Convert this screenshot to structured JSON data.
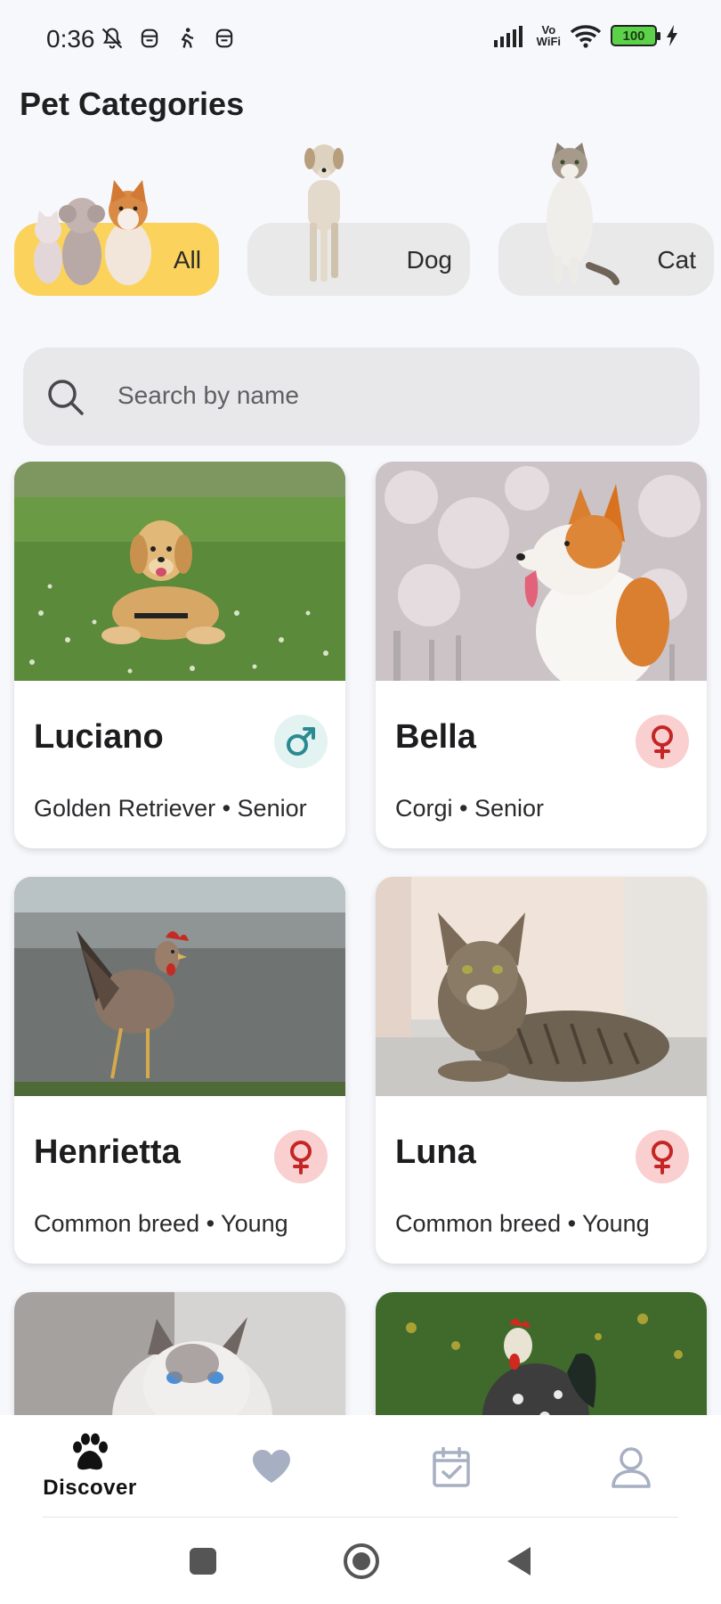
{
  "status_bar": {
    "time": "0:36",
    "left_icons": [
      "bell-off-icon",
      "face-icon",
      "walking-icon",
      "face-icon"
    ],
    "network": "Vo WiFi",
    "battery": "100"
  },
  "categories": {
    "title": "Pet Categories",
    "items": [
      {
        "label": "All",
        "active": true
      },
      {
        "label": "Dog",
        "active": false
      },
      {
        "label": "Cat",
        "active": false
      }
    ]
  },
  "search": {
    "placeholder": "Search by name"
  },
  "pets": [
    {
      "name": "Luciano",
      "breed": "Golden Retriever",
      "age": "Senior",
      "meta": "Golden Retriever • Senior",
      "gender": "male",
      "photo": "golden-retriever-photo"
    },
    {
      "name": "Bella",
      "breed": "Corgi",
      "age": "Senior",
      "meta": "Corgi • Senior",
      "gender": "female",
      "photo": "corgi-photo"
    },
    {
      "name": "Henrietta",
      "breed": "Common breed",
      "age": "Young",
      "meta": "Common breed • Young",
      "gender": "female",
      "photo": "hen-photo"
    },
    {
      "name": "Luna",
      "breed": "Common breed",
      "age": "Young",
      "meta": "Common breed • Young",
      "gender": "female",
      "photo": "tabby-cat-photo"
    },
    {
      "name": "",
      "photo": "white-cat-photo"
    },
    {
      "name": "",
      "photo": "rooster-photo"
    }
  ],
  "bottom_nav": {
    "items": [
      {
        "label": "Discover",
        "icon": "paw-icon",
        "active": true
      },
      {
        "label": "",
        "icon": "heart-icon",
        "active": false
      },
      {
        "label": "",
        "icon": "calendar-check-icon",
        "active": false
      },
      {
        "label": "",
        "icon": "user-icon",
        "active": false
      }
    ]
  },
  "colors": {
    "accent": "#fbd35c",
    "male_bg": "#e2f3f1",
    "male_fg": "#2a8a92",
    "female_bg": "#f9cfd0",
    "female_fg": "#c42626",
    "nav_inactive": "#a7afc2"
  }
}
